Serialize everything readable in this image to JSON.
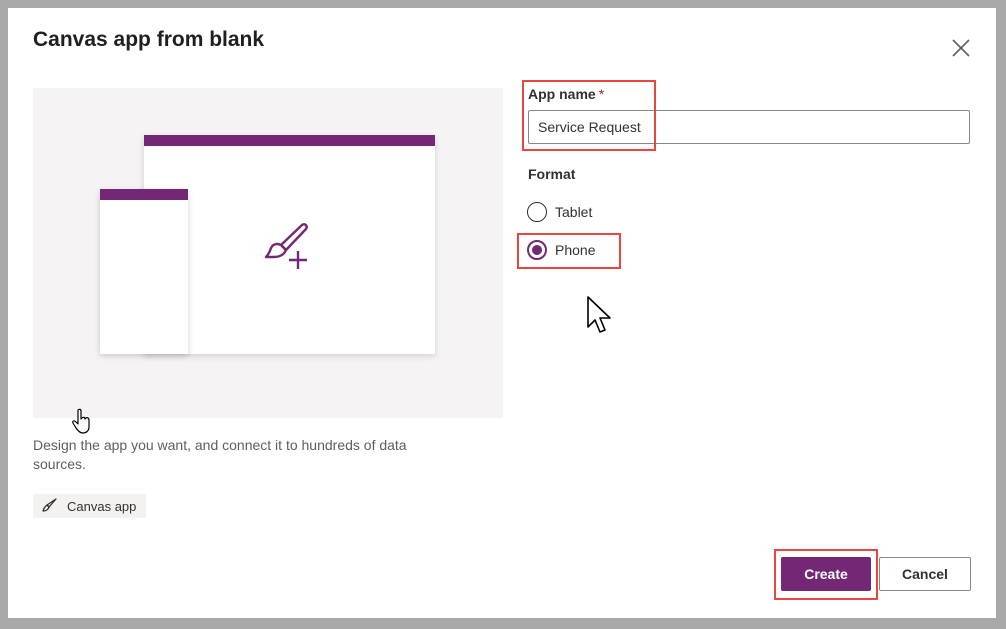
{
  "dialog": {
    "title": "Canvas app from blank",
    "description": "Design the app you want, and connect it to hundreds of data sources.",
    "tag_label": "Canvas app"
  },
  "form": {
    "app_name_label": "App name",
    "required_marker": "*",
    "app_name_value": "Service Request",
    "format_label": "Format",
    "format_options": [
      {
        "label": "Tablet",
        "selected": false
      },
      {
        "label": "Phone",
        "selected": true
      }
    ]
  },
  "buttons": {
    "create": "Create",
    "cancel": "Cancel"
  },
  "colors": {
    "accent": "#742774",
    "highlight": "#e8463f"
  },
  "icons": {
    "close": "close-icon",
    "brush_add": "paintbrush-add-icon",
    "tag": "paintbrush-icon"
  }
}
